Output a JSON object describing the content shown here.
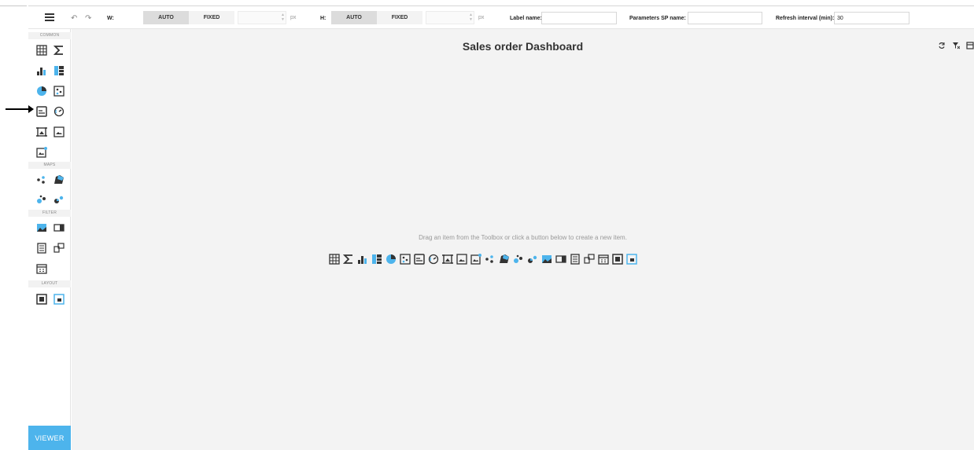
{
  "toolbar": {
    "w_label": "W:",
    "h_label": "H:",
    "auto_label": "AUTO",
    "fixed_label": "FIXED",
    "px_unit": "px",
    "label_name_label": "Label name:",
    "label_name_value": "",
    "sp_name_label": "Parameters SP name:",
    "sp_name_value": "",
    "refresh_label": "Refresh interval (min):",
    "refresh_value": "30",
    "undo_icon": "undo-icon",
    "redo_icon": "redo-icon"
  },
  "sidebar": {
    "sections": [
      "COMMON",
      "MAPS",
      "FILTER",
      "LAYOUT"
    ],
    "viewer_label": "VIEWER",
    "items": [
      {
        "name": "grid",
        "icon": "grid-icon"
      },
      {
        "name": "pivot",
        "icon": "sigma-icon"
      },
      {
        "name": "chart",
        "icon": "bar-chart-icon"
      },
      {
        "name": "treemap",
        "icon": "treemap-icon"
      },
      {
        "name": "pie",
        "icon": "pie-chart-icon"
      },
      {
        "name": "scatter",
        "icon": "scatter-icon"
      },
      {
        "name": "card",
        "icon": "card-icon"
      },
      {
        "name": "gauge",
        "icon": "gauge-icon"
      },
      {
        "name": "bound-image",
        "icon": "bound-image-icon"
      },
      {
        "name": "image",
        "icon": "image-icon"
      },
      {
        "name": "text-box",
        "icon": "text-box-icon"
      },
      {
        "name": "geo-point",
        "icon": "geo-point-icon"
      },
      {
        "name": "choropleth",
        "icon": "choropleth-icon"
      },
      {
        "name": "bubble-map",
        "icon": "bubble-map-icon"
      },
      {
        "name": "pie-map",
        "icon": "pie-map-icon"
      },
      {
        "name": "range-filter",
        "icon": "range-filter-icon"
      },
      {
        "name": "combo-box",
        "icon": "combo-box-icon"
      },
      {
        "name": "list-box",
        "icon": "list-box-icon"
      },
      {
        "name": "tree-view",
        "icon": "tree-view-icon"
      },
      {
        "name": "date-filter",
        "icon": "calendar-icon"
      },
      {
        "name": "group",
        "icon": "group-icon"
      },
      {
        "name": "tab-container",
        "icon": "tab-container-icon"
      }
    ]
  },
  "dashboard": {
    "title": "Sales order Dashboard",
    "hint": "Drag an item from the Toolbox or click a button below to create a new item.",
    "title_icons": [
      "refresh-icon",
      "clear-filter-icon",
      "export-icon"
    ]
  },
  "colors": {
    "accent": "#4db4ec",
    "icon_dark": "#333333",
    "canvas_bg": "#f3f3f3"
  }
}
